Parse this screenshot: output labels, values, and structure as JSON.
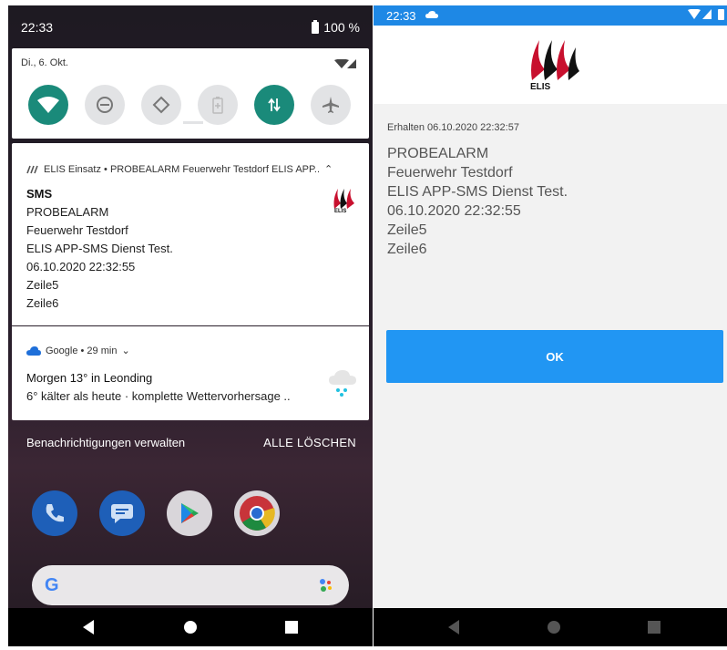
{
  "left": {
    "status": {
      "time": "22:33",
      "battery": "100 %"
    },
    "quick_settings": {
      "date": "Di., 6. Okt.",
      "tiles": [
        {
          "icon": "wifi-icon",
          "active": true
        },
        {
          "icon": "do-not-disturb-icon",
          "active": false
        },
        {
          "icon": "auto-rotate-icon",
          "active": false
        },
        {
          "icon": "battery-saver-icon",
          "active": false
        },
        {
          "icon": "mobile-data-icon",
          "active": true
        },
        {
          "icon": "airplane-mode-icon",
          "active": false
        }
      ]
    },
    "notification_elis": {
      "header": "ELIS Einsatz • PROBEALARM Feuerwehr Testdorf ELIS APP..",
      "title": "SMS",
      "lines": [
        "PROBEALARM",
        "Feuerwehr Testdorf",
        "ELIS APP-SMS Dienst Test.",
        "06.10.2020 22:32:55",
        "Zeile5",
        "Zeile6"
      ],
      "logo_text": "ELIS"
    },
    "notification_google": {
      "header": "Google • 29 min",
      "title": "Morgen 13° in Leonding",
      "text": "6° kälter als heute · komplette Wettervorhersage .."
    },
    "manage_label": "Benachrichtigungen verwalten",
    "clear_all_label": "ALLE LÖSCHEN",
    "dock_apps": [
      "phone-icon",
      "messages-icon",
      "play-store-icon",
      "chrome-icon"
    ]
  },
  "right": {
    "status": {
      "time": "22:33"
    },
    "logo_text": "ELIS",
    "received": "Erhalten 06.10.2020 22:32:57",
    "message_lines": [
      "PROBEALARM",
      "Feuerwehr Testdorf",
      "ELIS APP-SMS Dienst Test.",
      "06.10.2020 22:32:55",
      "Zeile5",
      "Zeile6"
    ],
    "ok_label": "OK"
  },
  "colors": {
    "accent_teal": "#1a8a7a",
    "status_blue": "#1e88e5",
    "button_blue": "#2196f3",
    "logo_red": "#c8102e"
  }
}
